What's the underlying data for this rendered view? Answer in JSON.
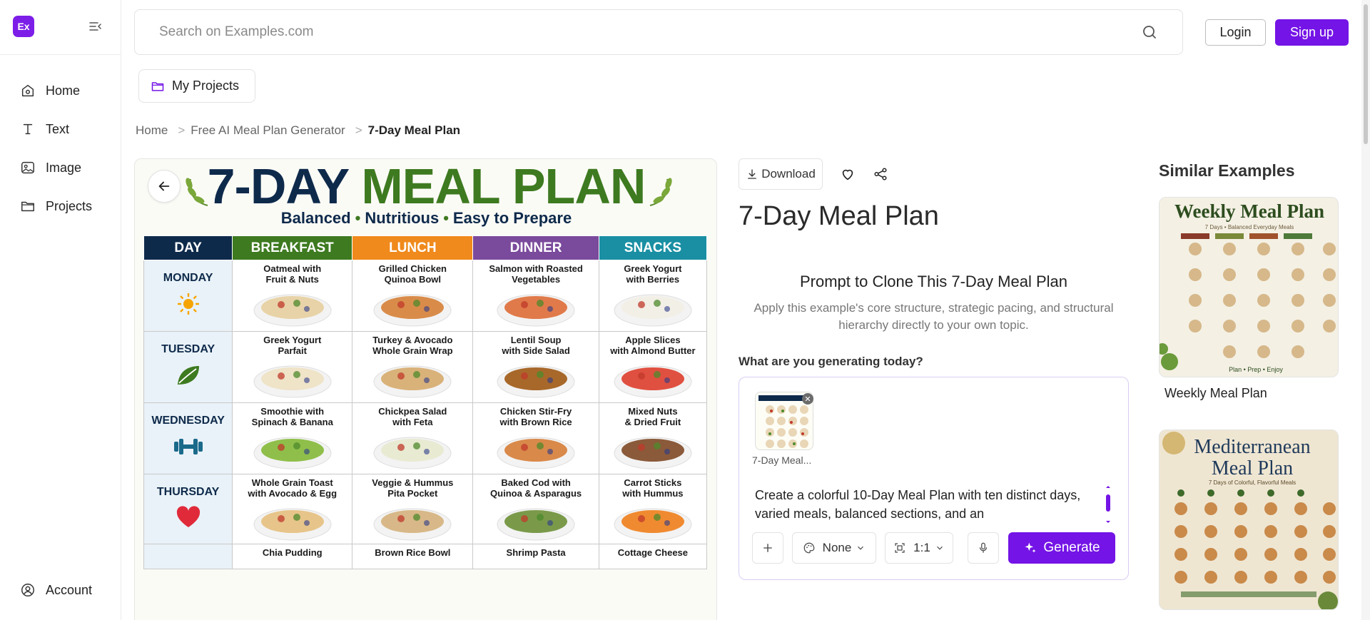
{
  "brand": {
    "logo_text": "Ex",
    "accent": "#7414e6"
  },
  "sidebar": {
    "items": [
      {
        "label": "Home",
        "icon": "home-icon"
      },
      {
        "label": "Text",
        "icon": "text-icon"
      },
      {
        "label": "Image",
        "icon": "image-icon"
      },
      {
        "label": "Projects",
        "icon": "folder-icon"
      }
    ],
    "account_label": "Account"
  },
  "header": {
    "search_placeholder": "Search on Examples.com",
    "login_label": "Login",
    "signup_label": "Sign up"
  },
  "my_projects_label": "My Projects",
  "breadcrumb": {
    "items": [
      "Home",
      "Free AI Meal Plan Generator"
    ],
    "separator": ">",
    "current": "7-Day Meal Plan"
  },
  "meal_plan": {
    "title_part1": "7-DAY",
    "title_part2": "MEAL PLAN",
    "subtitle": [
      "Balanced",
      "Nutritious",
      "Easy to Prepare"
    ],
    "columns": [
      {
        "label": "DAY",
        "color": "#0e2a4b"
      },
      {
        "label": "BREAKFAST",
        "color": "#3e7a20"
      },
      {
        "label": "LUNCH",
        "color": "#f08a1c"
      },
      {
        "label": "DINNER",
        "color": "#7a4a9c"
      },
      {
        "label": "SNACKS",
        "color": "#1a8fa3"
      }
    ],
    "rows": [
      {
        "day": "MONDAY",
        "icon": "sun-icon",
        "meals": [
          "Oatmeal with\nFruit & Nuts",
          "Grilled Chicken\nQuinoa Bowl",
          "Salmon with Roasted\nVegetables",
          "Greek Yogurt\nwith Berries"
        ]
      },
      {
        "day": "TUESDAY",
        "icon": "leaf-icon",
        "meals": [
          "Greek Yogurt\nParfait",
          "Turkey & Avocado\nWhole Grain Wrap",
          "Lentil Soup\nwith Side Salad",
          "Apple Slices\nwith Almond Butter"
        ]
      },
      {
        "day": "WEDNESDAY",
        "icon": "dumbbell-icon",
        "meals": [
          "Smoothie with\nSpinach & Banana",
          "Chickpea Salad\nwith Feta",
          "Chicken Stir-Fry\nwith Brown Rice",
          "Mixed Nuts\n& Dried Fruit"
        ]
      },
      {
        "day": "THURSDAY",
        "icon": "heart-icon",
        "meals": [
          "Whole Grain Toast\nwith Avocado & Egg",
          "Veggie & Hummus\nPita Pocket",
          "Baked Cod with\nQuinoa & Asparagus",
          "Carrot Sticks\nwith Hummus"
        ]
      },
      {
        "day": "",
        "icon": "",
        "meals": [
          "Chia Pudding",
          "Brown Rice Bowl",
          "Shrimp Pasta",
          "Cottage Cheese"
        ]
      }
    ]
  },
  "detail": {
    "download_label": "Download",
    "title": "7-Day Meal Plan",
    "prompt_heading": "Prompt to Clone This 7-Day Meal Plan",
    "prompt_desc": "Apply this example's core structure, strategic pacing, and structural hierarchy directly to your own topic.",
    "gen_label": "What are you generating today?",
    "thumb_label": "7-Day Meal...",
    "prompt_text": "Create a colorful 10-Day Meal Plan with ten distinct days, varied meals, balanced sections, and an",
    "style_value": "None",
    "ratio_value": "1:1",
    "generate_label": "Generate"
  },
  "similar": {
    "title": "Similar Examples",
    "items": [
      {
        "label": "Weekly Meal Plan",
        "image_title": "Weekly Meal Plan",
        "image_sub": "7 Days • Balanced Everyday Meals",
        "image_footer": "Plan • Prep • Enjoy"
      },
      {
        "label": "",
        "image_title": "Mediterranean\nMeal Plan",
        "image_sub": "7 Days of Colorful, Flavorful Meals"
      }
    ]
  }
}
